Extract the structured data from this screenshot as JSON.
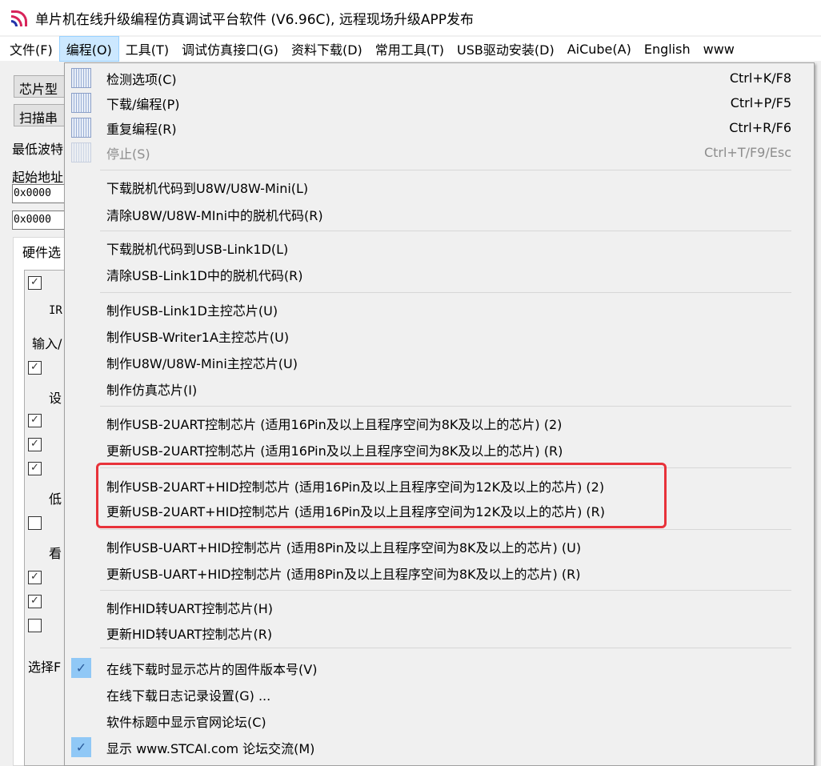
{
  "window": {
    "title": "单片机在线升级编程仿真调试平台软件 (V6.96C), 远程现场升级APP发布"
  },
  "menubar": [
    "文件(F)",
    "编程(O)",
    "工具(T)",
    "调试仿真接口(G)",
    "资料下载(D)",
    "常用工具(T)",
    "USB驱动安装(D)",
    "AiCube(A)",
    "English",
    "www"
  ],
  "background": {
    "buttons": [
      "芯片型",
      "扫描串"
    ],
    "labels": [
      "最低波特",
      "起始地址",
      "硬件选",
      "IR",
      "输入/",
      "设",
      "低",
      "看",
      "选择F"
    ],
    "inputs": [
      "0x0000",
      "0x0000"
    ],
    "checkboxes": [
      true,
      true,
      true,
      true,
      true,
      false,
      true,
      true,
      false
    ]
  },
  "menu": {
    "items": [
      {
        "label": "检测选项(C)",
        "shortcut": "Ctrl+K/F8",
        "icon": "detect-icon"
      },
      {
        "label": "下载/编程(P)",
        "shortcut": "Ctrl+P/F5",
        "icon": "download-icon"
      },
      {
        "label": "重复编程(R)",
        "shortcut": "Ctrl+R/F6",
        "icon": "repeat-program-icon"
      },
      {
        "label": "停止(S)",
        "shortcut": "Ctrl+T/F9/Esc",
        "icon": "stop-icon",
        "disabled": true
      },
      {
        "label": "下载脱机代码到U8W/U8W-Mini(L)"
      },
      {
        "label": "清除U8W/U8W-MIni中的脱机代码(R)"
      },
      {
        "label": "下载脱机代码到USB-Link1D(L)"
      },
      {
        "label": "清除USB-Link1D中的脱机代码(R)"
      },
      {
        "label": "制作USB-Link1D主控芯片(U)"
      },
      {
        "label": "制作USB-Writer1A主控芯片(U)"
      },
      {
        "label": "制作U8W/U8W-Mini主控芯片(U)"
      },
      {
        "label": "制作仿真芯片(I)"
      },
      {
        "label": "制作USB-2UART控制芯片 (适用16Pin及以上且程序空间为8K及以上的芯片) (2)"
      },
      {
        "label": "更新USB-2UART控制芯片 (适用16Pin及以上且程序空间为8K及以上的芯片) (R)"
      },
      {
        "label": "制作USB-2UART+HID控制芯片 (适用16Pin及以上且程序空间为12K及以上的芯片) (2)"
      },
      {
        "label": "更新USB-2UART+HID控制芯片 (适用16Pin及以上且程序空间为12K及以上的芯片) (R)"
      },
      {
        "label": "制作USB-UART+HID控制芯片 (适用8Pin及以上且程序空间为8K及以上的芯片) (U)"
      },
      {
        "label": "更新USB-UART+HID控制芯片 (适用8Pin及以上且程序空间为8K及以上的芯片) (R)"
      },
      {
        "label": "制作HID转UART控制芯片(H)"
      },
      {
        "label": "更新HID转UART控制芯片(R)"
      },
      {
        "label": "在线下载时显示芯片的固件版本号(V)",
        "checked": true
      },
      {
        "label": "在线下载日志记录设置(G) ..."
      },
      {
        "label": "软件标题中显示官网论坛(C)"
      },
      {
        "label": "显示 www.STCAI.com 论坛交流(M)",
        "checked": true
      }
    ]
  },
  "colors": {
    "highlight": "#e8323a",
    "menu_active": "#cce8ff",
    "check_bg": "#90c8f6"
  }
}
